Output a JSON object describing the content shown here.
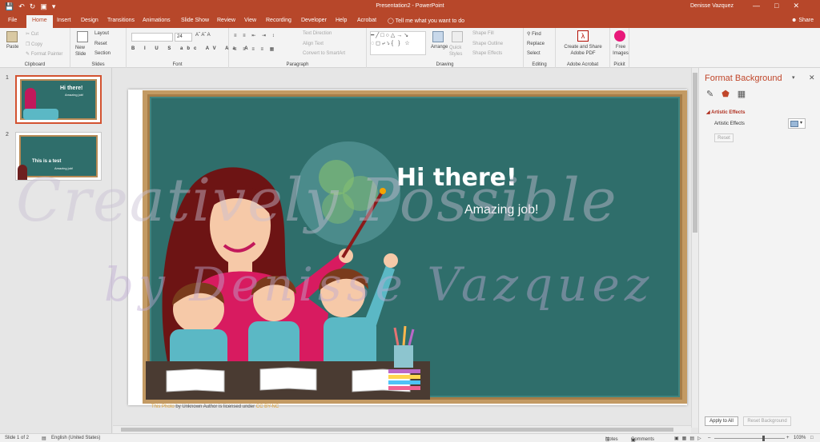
{
  "titlebar": {
    "title": "Presentation2 - PowerPoint",
    "user": "Denisse Vazquez",
    "qat": [
      "save-icon",
      "undo-icon",
      "redo-icon",
      "present-icon",
      "customize-icon"
    ]
  },
  "tabs": [
    "File",
    "Home",
    "Insert",
    "Design",
    "Transitions",
    "Animations",
    "Slide Show",
    "Review",
    "View",
    "Recording",
    "Developer",
    "Help",
    "Acrobat"
  ],
  "active_tab": "Home",
  "tell_me": "Tell me what you want to do",
  "share": "Share",
  "ribbon": {
    "clipboard": {
      "label": "Clipboard",
      "paste": "Paste",
      "cut": "Cut",
      "copy": "Copy",
      "format_painter": "Format Painter"
    },
    "slides": {
      "label": "Slides",
      "new_slide": "New Slide",
      "layout": "Layout",
      "reset": "Reset",
      "section": "Section"
    },
    "font": {
      "label": "Font",
      "font_name": "",
      "font_size": "24"
    },
    "paragraph": {
      "label": "Paragraph",
      "text_direction": "Text Direction",
      "align_text": "Align Text",
      "smartart": "Convert to SmartArt"
    },
    "drawing": {
      "label": "Drawing",
      "arrange": "Arrange",
      "quick_styles": "Quick Styles",
      "shape_fill": "Shape Fill",
      "shape_outline": "Shape Outline",
      "shape_effects": "Shape Effects"
    },
    "editing": {
      "label": "Editing",
      "find": "Find",
      "replace": "Replace",
      "select": "Select"
    },
    "acrobat": {
      "label": "Adobe Acrobat",
      "create_share": "Create and Share Adobe PDF"
    },
    "pickit": {
      "label": "Pickit",
      "free_images": "Free Images"
    }
  },
  "thumbnails": [
    {
      "num": "1",
      "title": "Hi there!",
      "subtitle": "Amazing job!"
    },
    {
      "num": "2",
      "title": "This is a test",
      "subtitle": "Amazing job!"
    }
  ],
  "slide": {
    "title": "Hi there!",
    "subtitle": "Amazing job!"
  },
  "credit": {
    "pre": "This Photo",
    "mid": " by Unknown Author is licensed under ",
    "post": "CC BY-NC"
  },
  "watermark": {
    "line1": "Creatively Possible",
    "line2": "by Denisse Vazquez"
  },
  "format_background": {
    "title": "Format Background",
    "section": "Artistic Effects",
    "artistic_effects_label": "Artistic Effects",
    "reset": "Reset",
    "apply_all": "Apply to All",
    "reset_background": "Reset Background"
  },
  "statusbar": {
    "slide_count": "Slide 1 of 2",
    "language": "English (United States)",
    "notes": "Notes",
    "comments": "Comments",
    "zoom": "103%"
  },
  "colors": {
    "accent": "#b7472a",
    "board": "#2f6e6b",
    "frame": "#c39a63"
  }
}
